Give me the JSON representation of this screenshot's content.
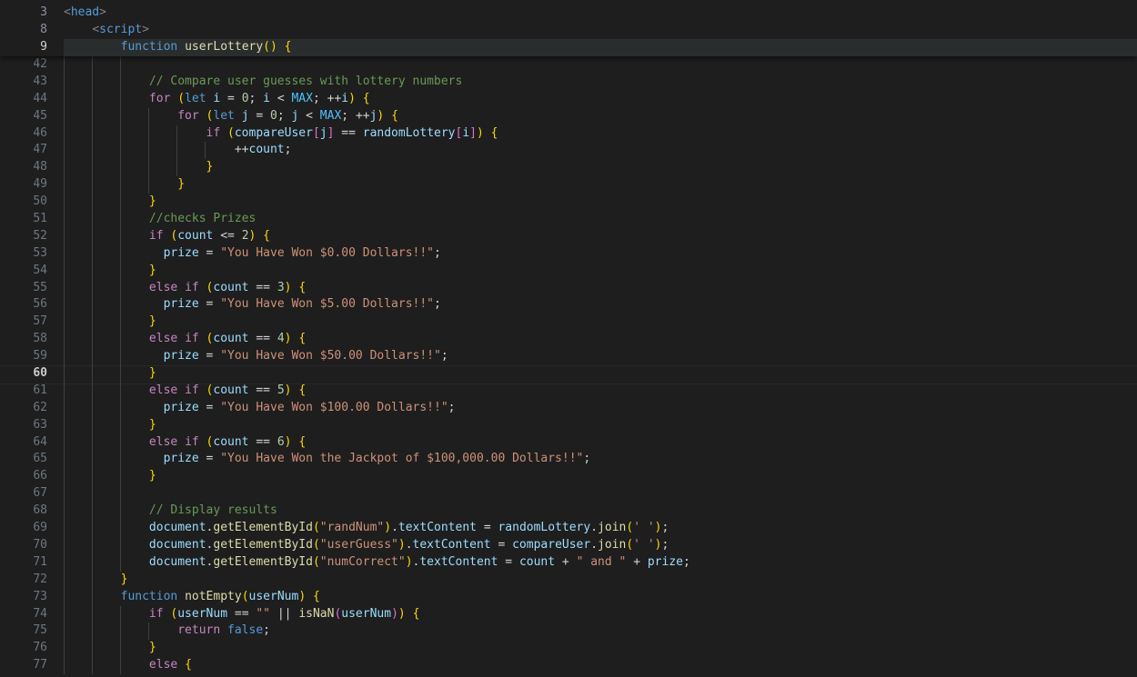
{
  "editor": {
    "app": "code-editor",
    "theme": "dark-plus",
    "language": "html",
    "background_color": "#1e1e1e",
    "gutter_color": "#6e7681",
    "current_line_number": 60,
    "sticky_active_line": 9,
    "colors": {
      "comment": "#6A9955",
      "keyword": "#C586C0",
      "keyword_alt": "#569CD6",
      "variable": "#9CDCFE",
      "constant": "#4FC1FF",
      "number": "#B5CEA8",
      "string": "#CE9178",
      "function": "#DCDCAA",
      "operator": "#d4d4d4",
      "bracket1": "#FFD700",
      "bracket2": "#DA70D6",
      "bracket3": "#179FFF",
      "line_highlight": "#2a2d2e",
      "indent_guide": "#404040"
    }
  },
  "sticky_scroll": {
    "lines": [
      {
        "number": 3,
        "text": "<head>",
        "cut": false,
        "active": false
      },
      {
        "number": 8,
        "text": "    <script>",
        "cut": false,
        "active": false
      },
      {
        "number": 9,
        "text": "        function userLottery() {",
        "cut": false,
        "active": true
      }
    ]
  },
  "code": {
    "lines": [
      {
        "number": 42,
        "text": ""
      },
      {
        "number": 43,
        "text": "            // Compare user guesses with lottery numbers"
      },
      {
        "number": 44,
        "text": "            for (let i = 0; i < MAX; ++i) {"
      },
      {
        "number": 45,
        "text": "                for (let j = 0; j < MAX; ++j) {"
      },
      {
        "number": 46,
        "text": "                    if (compareUser[j] == randomLottery[i]) {"
      },
      {
        "number": 47,
        "text": "                        ++count;"
      },
      {
        "number": 48,
        "text": "                    }"
      },
      {
        "number": 49,
        "text": "                }"
      },
      {
        "number": 50,
        "text": "            }"
      },
      {
        "number": 51,
        "text": "            //checks Prizes"
      },
      {
        "number": 52,
        "text": "            if (count <= 2) {"
      },
      {
        "number": 53,
        "text": "              prize = \"You Have Won $0.00 Dollars!!\";"
      },
      {
        "number": 54,
        "text": "            }"
      },
      {
        "number": 55,
        "text": "            else if (count == 3) {"
      },
      {
        "number": 56,
        "text": "              prize = \"You Have Won $5.00 Dollars!!\";"
      },
      {
        "number": 57,
        "text": "            }"
      },
      {
        "number": 58,
        "text": "            else if (count == 4) {"
      },
      {
        "number": 59,
        "text": "              prize = \"You Have Won $50.00 Dollars!!\";"
      },
      {
        "number": 60,
        "text": "            }"
      },
      {
        "number": 61,
        "text": "            else if (count == 5) {"
      },
      {
        "number": 62,
        "text": "              prize = \"You Have Won $100.00 Dollars!!\";"
      },
      {
        "number": 63,
        "text": "            }"
      },
      {
        "number": 64,
        "text": "            else if (count == 6) {"
      },
      {
        "number": 65,
        "text": "              prize = \"You Have Won the Jackpot of $100,000.00 Dollars!!\";"
      },
      {
        "number": 66,
        "text": "            }"
      },
      {
        "number": 67,
        "text": ""
      },
      {
        "number": 68,
        "text": "            // Display results"
      },
      {
        "number": 69,
        "text": "            document.getElementById(\"randNum\").textContent = randomLottery.join(' ');"
      },
      {
        "number": 70,
        "text": "            document.getElementById(\"userGuess\").textContent = compareUser.join(' ');"
      },
      {
        "number": 71,
        "text": "            document.getElementById(\"numCorrect\").textContent = count + \" and \" + prize;"
      },
      {
        "number": 72,
        "text": "        }"
      },
      {
        "number": 73,
        "text": "        function notEmpty(userNum) {"
      },
      {
        "number": 74,
        "text": "            if (userNum == \"\" || isNaN(userNum)) {"
      },
      {
        "number": 75,
        "text": "                return false;"
      },
      {
        "number": 76,
        "text": "            }"
      },
      {
        "number": 77,
        "text": "            else {"
      }
    ]
  }
}
